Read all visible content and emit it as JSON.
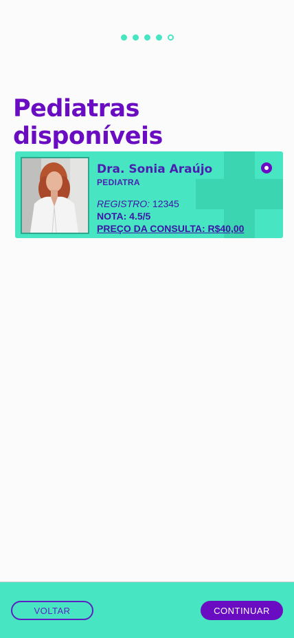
{
  "progress": {
    "total_steps": 5,
    "completed_steps": 4
  },
  "page": {
    "title": "Pediatras disponíveis"
  },
  "doctors": [
    {
      "name": "Dra. Sonia Araújo",
      "specialty": "PEDIATRA",
      "registro_label": "REGISTRO:",
      "registro_value": "12345",
      "nota": "NOTA: 4.5/5",
      "price": "PREÇO DA CONSULTA: R$40,00",
      "selected": true
    }
  ],
  "footer": {
    "back_label": "VOLTAR",
    "continue_label": "CONTINUAR"
  },
  "colors": {
    "accent": "#48e5c2",
    "primary": "#6a0dc2",
    "text": "#3d14a6"
  }
}
